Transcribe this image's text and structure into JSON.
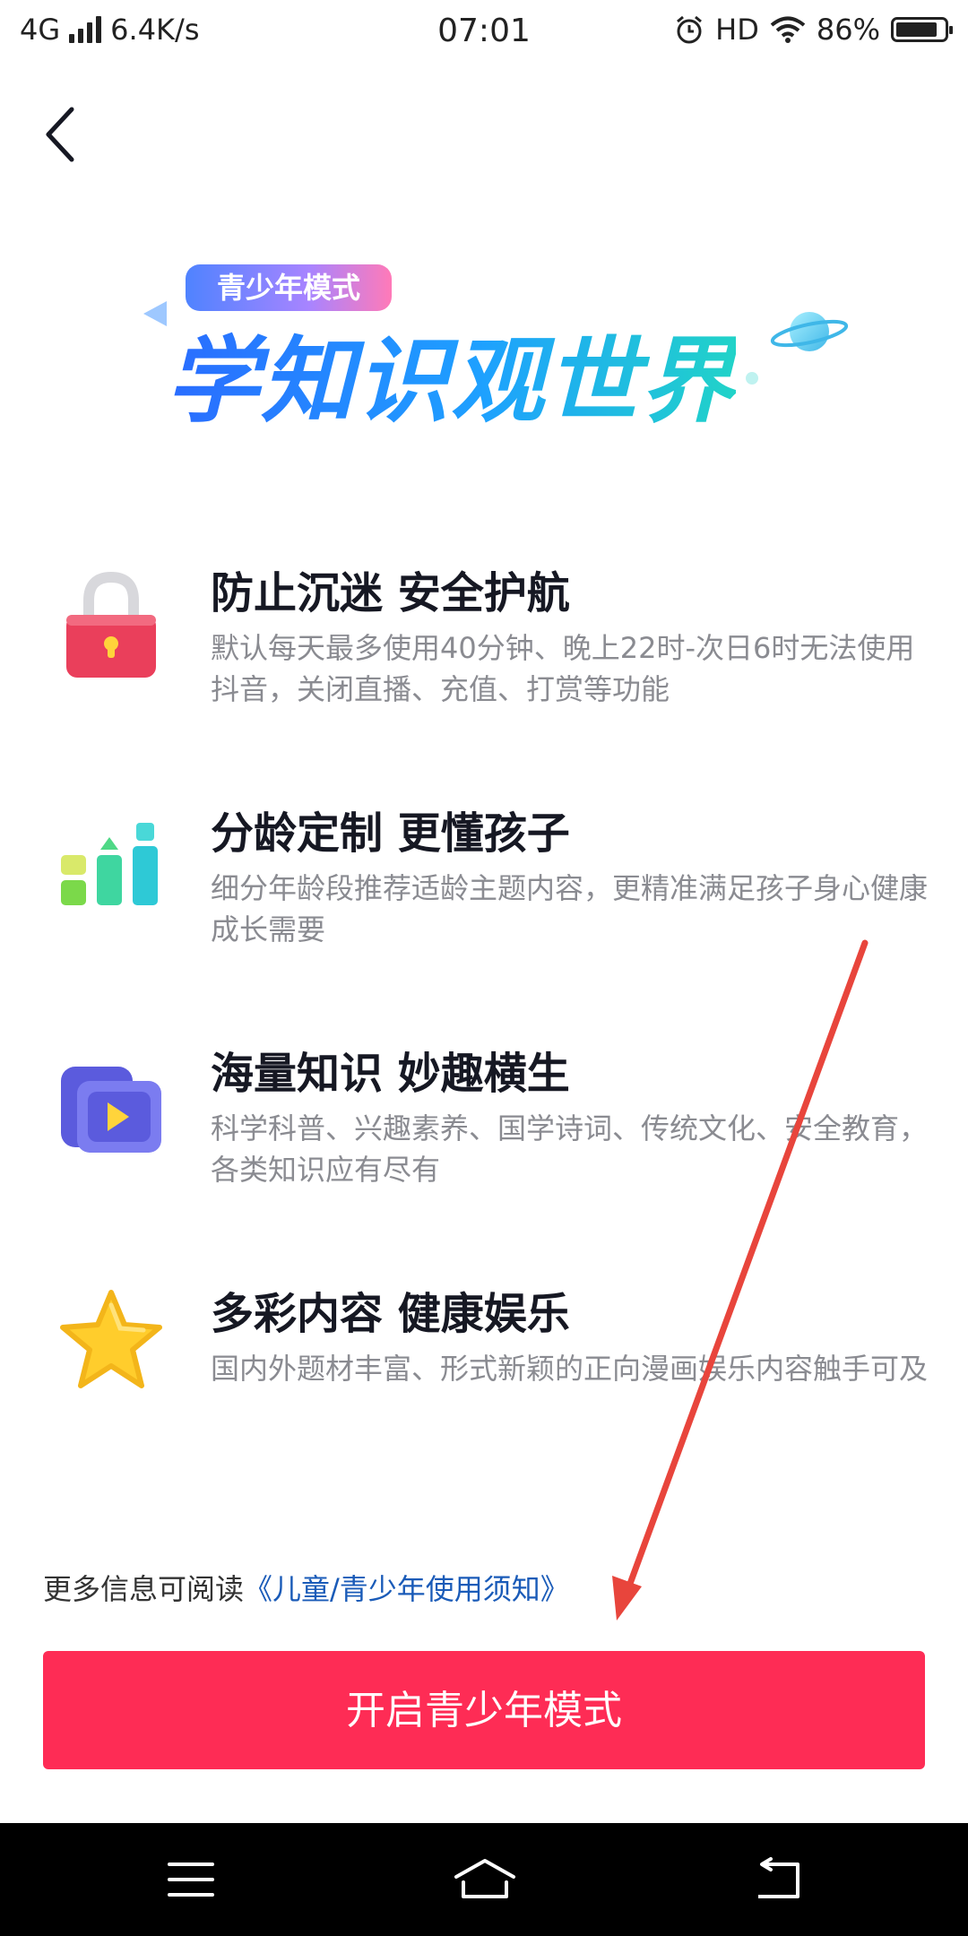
{
  "status_bar": {
    "network": "4G",
    "speed": "6.4K/s",
    "time": "07:01",
    "hd": "HD",
    "battery": "86%",
    "battery_level": 0.86
  },
  "hero": {
    "badge": "青少年模式",
    "title": "学知识观世界"
  },
  "features": [
    {
      "icon": "lock-icon",
      "title": "防止沉迷 安全护航",
      "desc": "默认每天最多使用40分钟、晚上22时-次日6时无法使用抖音，关闭直播、充值、打赏等功能"
    },
    {
      "icon": "bar-chart-icon",
      "title": "分龄定制 更懂孩子",
      "desc": "细分年龄段推荐适龄主题内容，更精准满足孩子身心健康成长需要"
    },
    {
      "icon": "video-folder-icon",
      "title": "海量知识 妙趣横生",
      "desc": "科学科普、兴趣素养、国学诗词、传统文化、安全教育，各类知识应有尽有"
    },
    {
      "icon": "star-icon",
      "title": "多彩内容 健康娱乐",
      "desc": "国内外题材丰富、形式新颖的正向漫画娱乐内容触手可及"
    }
  ],
  "footer": {
    "more_prefix": "更多信息可阅读",
    "more_link": "《儿童/青少年使用须知》"
  },
  "cta": {
    "label": "开启青少年模式"
  },
  "colors": {
    "primary": "#fe2c55",
    "link": "#1a5bb8",
    "arrow": "#e8453c"
  }
}
